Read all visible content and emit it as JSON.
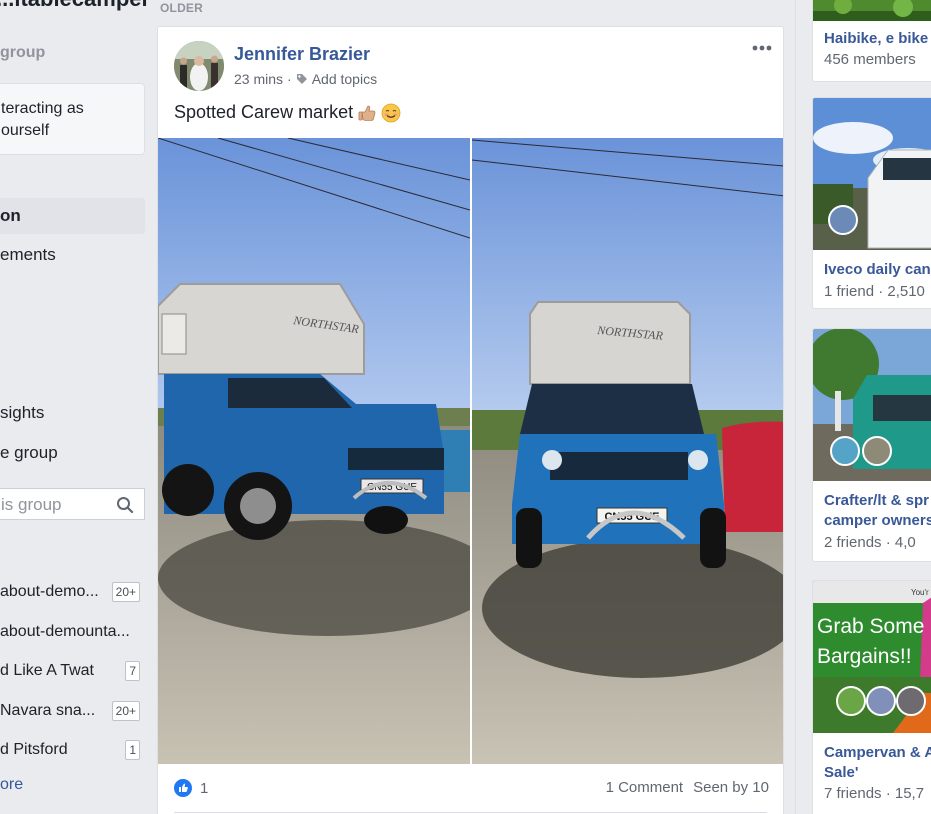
{
  "sidebar": {
    "group_title": "...itablecamper",
    "section_label": "group",
    "interacting_box": "teracting as\nourself",
    "nav": [
      {
        "label": "on",
        "active": true
      },
      {
        "label": "ements"
      },
      {
        "label": "sights"
      },
      {
        "label": "e group"
      }
    ],
    "search_placeholder": "is group",
    "chats": [
      {
        "name": "about-demo...",
        "count": "20+"
      },
      {
        "name": "about-demounta...",
        "count": ""
      },
      {
        "name": "d Like A Twat",
        "count": "7"
      },
      {
        "name": " Navara sna...",
        "count": "20+"
      },
      {
        "name": "d Pitsford",
        "count": "1"
      }
    ],
    "see_more": "ore"
  },
  "feed": {
    "section_label": "OLDER",
    "post": {
      "author": "Jennifer Brazier",
      "time": "23 mins",
      "separator": "·",
      "add_topics": "Add topics",
      "text": "Spotted Carew market",
      "photo_left_plate": "CN55 GUE",
      "photo_right_plate": "CN55 GUE",
      "photo_brand": "NORTHSTAR",
      "like_count": "1",
      "comments": "1 Comment",
      "seen_by": "Seen by 10"
    }
  },
  "suggestions": [
    {
      "name": "Haibike, e bike",
      "meta": "456 members"
    },
    {
      "name": "Iveco daily can",
      "meta": "1 friend · 2,510"
    },
    {
      "name_line1": "Crafter/lt & spr",
      "name_line2": "camper owners",
      "meta": "2 friends · 4,0"
    },
    {
      "name_line1": "Campervan & A",
      "name_line2": "Sale'",
      "meta": "7 friends · 15,7",
      "banner_line1": "Grab Some",
      "banner_line2": "Bargains!!",
      "banner_small": "You'r"
    }
  ],
  "colors": {
    "link_blue": "#385898",
    "page_bg": "#e9ebee",
    "banner_green": "#2e8b2e"
  }
}
